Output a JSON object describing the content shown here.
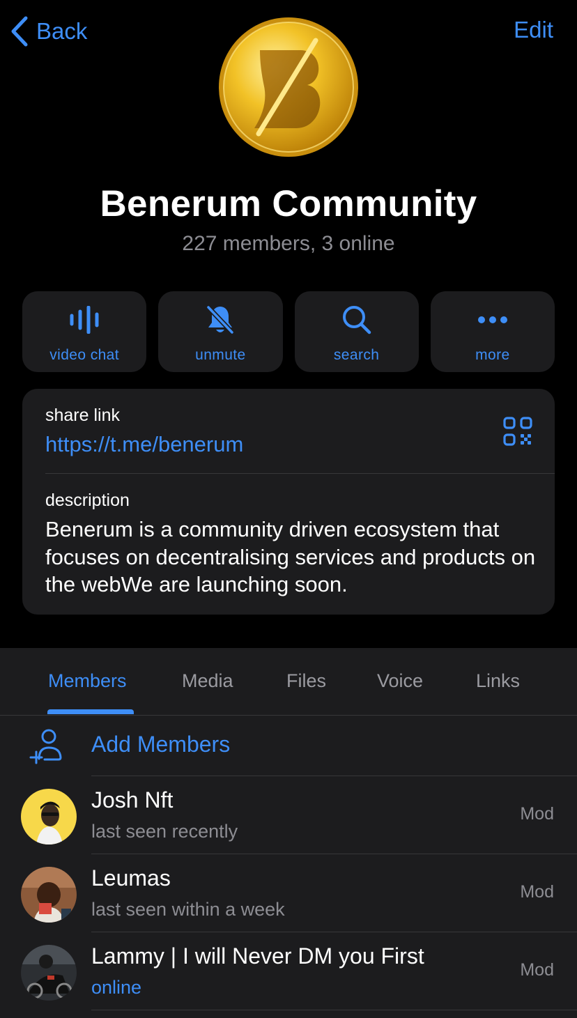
{
  "nav": {
    "back_label": "Back",
    "edit_label": "Edit"
  },
  "group": {
    "name": "Benerum Community",
    "subtitle": "227 members, 3 online"
  },
  "actions": [
    {
      "label": "video chat",
      "icon": "voice-chat-icon"
    },
    {
      "label": "unmute",
      "icon": "bell-slash-icon"
    },
    {
      "label": "search",
      "icon": "search-icon"
    },
    {
      "label": "more",
      "icon": "ellipsis-icon"
    }
  ],
  "info": {
    "share_label": "share link",
    "share_url": "https://t.me/benerum",
    "description_label": "description",
    "description": "Benerum is a community driven ecosystem that focuses on decentralising services and products on the webWe are launching soon."
  },
  "tabs": [
    "Members",
    "Media",
    "Files",
    "Voice",
    "Links"
  ],
  "active_tab": "Members",
  "add_members_label": "Add Members",
  "members": [
    {
      "name": "Josh Nft",
      "status": "last seen recently",
      "role": "Mod"
    },
    {
      "name": "Leumas",
      "status": "last seen within a week",
      "role": "Mod"
    },
    {
      "name": "Lammy | I will Never DM you First",
      "status": "online",
      "role": "Mod"
    }
  ],
  "colors": {
    "accent": "#3e8ef7",
    "background": "#000000",
    "card": "#1c1c1e",
    "secondary_text": "#8d8d93",
    "coin_gold": "#e8b31c"
  }
}
